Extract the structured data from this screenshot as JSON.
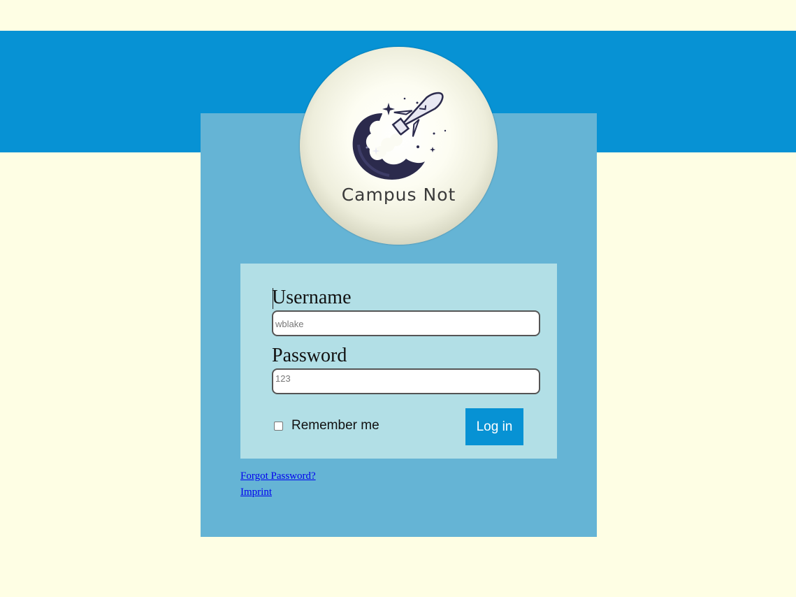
{
  "logo": {
    "text": "Campus Not",
    "icon": "rocket-moon-icon"
  },
  "form": {
    "username_label": "Username",
    "username_value": "wblake",
    "password_label": "Password",
    "password_value": "123",
    "remember_label": "Remember me",
    "remember_checked": false,
    "login_label": "Log in"
  },
  "links": {
    "forgot_password": "Forgot Password?",
    "imprint": "Imprint"
  },
  "colors": {
    "page_background": "#fefee4",
    "band": "#0792d4",
    "card": "#65b4d5",
    "panel": "#b2dfe6",
    "button": "#0792d4"
  }
}
